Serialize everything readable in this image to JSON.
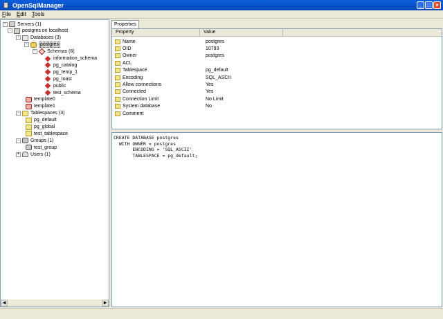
{
  "window": {
    "title": "OpenSqlManager"
  },
  "menu": [
    {
      "acc": "F",
      "rest": "ile"
    },
    {
      "acc": "E",
      "rest": "dit"
    },
    {
      "acc": "T",
      "rest": "ools"
    }
  ],
  "tree": [
    {
      "label": "Servers (1)",
      "icon": "server-icon",
      "exp": "-"
    },
    {
      "label": "postgres on localhost",
      "icon": "server-icon",
      "exp": "-"
    },
    {
      "label": "Databases (3)",
      "icon": "databases-icon",
      "exp": "-"
    },
    {
      "label": "postgres",
      "icon": "database-icon",
      "exp": "-",
      "selected": true
    },
    {
      "label": "Schemas (6)",
      "icon": "schemas-icon",
      "exp": "-"
    },
    {
      "label": "information_schema",
      "icon": "schema-icon"
    },
    {
      "label": "pg_catalog",
      "icon": "schema-icon"
    },
    {
      "label": "pg_temp_1",
      "icon": "schema-icon"
    },
    {
      "label": "pg_toast",
      "icon": "schema-icon"
    },
    {
      "label": "public",
      "icon": "schema-icon"
    },
    {
      "label": "test_schema",
      "icon": "schema-icon"
    },
    {
      "label": "template0",
      "icon": "database-red-icon"
    },
    {
      "label": "template1",
      "icon": "database-red-icon"
    },
    {
      "label": "Tablespaces (3)",
      "icon": "tablespaces-icon",
      "exp": "-"
    },
    {
      "label": "pg_default",
      "icon": "folder-icon"
    },
    {
      "label": "pg_global",
      "icon": "folder-icon"
    },
    {
      "label": "test_tablespace",
      "icon": "folder-icon"
    },
    {
      "label": "Groups (1)",
      "icon": "groups-icon",
      "exp": "-"
    },
    {
      "label": "test_group",
      "icon": "group-icon"
    },
    {
      "label": "Users (1)",
      "icon": "users-icon",
      "exp": "+"
    }
  ],
  "tabs": {
    "properties": "Properties"
  },
  "props_header": {
    "property": "Property",
    "value": "Value"
  },
  "properties": [
    {
      "name": "Name",
      "value": "postgres"
    },
    {
      "name": "OID",
      "value": "10793"
    },
    {
      "name": "Owner",
      "value": "postgres"
    },
    {
      "name": "ACL",
      "value": ""
    },
    {
      "name": "Tablespace",
      "value": "pg_default"
    },
    {
      "name": "Encoding",
      "value": "SQL_ASCII"
    },
    {
      "name": "Allow connections",
      "value": "Yes"
    },
    {
      "name": "Connected",
      "value": "Yes"
    },
    {
      "name": "Connection Limit",
      "value": "No Limit"
    },
    {
      "name": "System database",
      "value": "No"
    },
    {
      "name": "Comment",
      "value": ""
    }
  ],
  "sql": [
    "CREATE DATABASE postgres",
    "  WITH OWNER = postgres",
    "       ENCODING = 'SQL_ASCII'",
    "       TABLESPACE = pg_default;"
  ]
}
